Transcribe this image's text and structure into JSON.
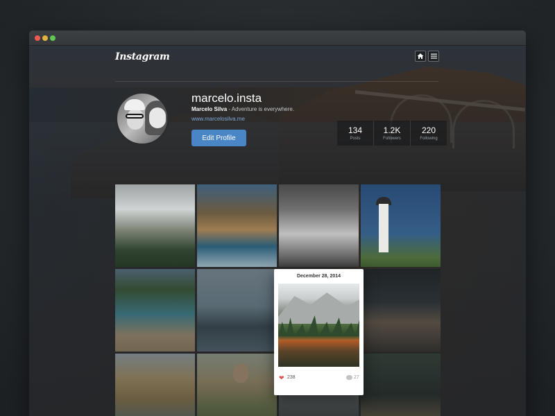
{
  "brand": {
    "logo": "Instagram",
    "accent": "#4a86c5"
  },
  "nav": {
    "home_icon": "home-icon",
    "menu_icon": "menu-icon"
  },
  "profile": {
    "username": "marcelo.insta",
    "full_name": "Marcelo Silva",
    "bio": " - Adventure is everywhere.",
    "website": "www.marcelosilva.me",
    "edit_button": "Edit Profile"
  },
  "stats": [
    {
      "value": "134",
      "label": "Posts"
    },
    {
      "value": "1.2K",
      "label": "Followers"
    },
    {
      "value": "220",
      "label": "Following"
    }
  ],
  "popup": {
    "date": "December 28, 2014",
    "likes": "238",
    "comments": "27"
  },
  "window_controls": [
    "close",
    "minimize",
    "zoom"
  ]
}
